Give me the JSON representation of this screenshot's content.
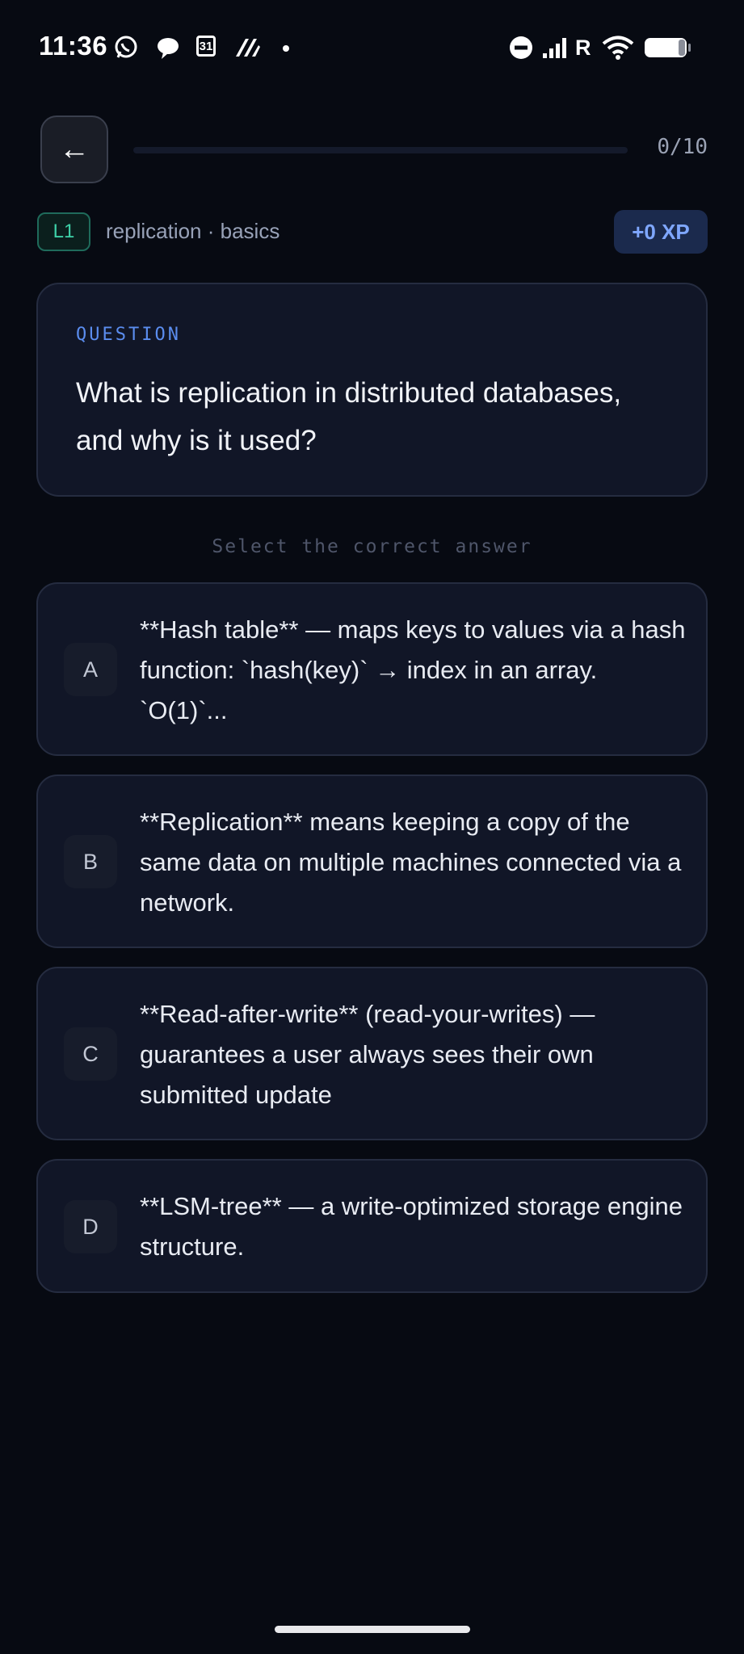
{
  "status_bar": {
    "time": "11:36",
    "calendar_day": "31",
    "carrier_indicator": "R"
  },
  "header": {
    "back_icon": "←",
    "progress": {
      "current": 0,
      "total": 10,
      "fraction": 0.0,
      "label": "0/10"
    }
  },
  "meta": {
    "level": "L1",
    "topic": "replication · basics",
    "xp": "+0 XP"
  },
  "question": {
    "label": "QUESTION",
    "text": "What is replication in distributed databases, and why is it used?"
  },
  "instruction": "Select the correct answer",
  "options": [
    {
      "letter": "A",
      "text": "**Hash table** — maps keys to values via a hash function: `hash(key)` → index in an array. `O(1)`..."
    },
    {
      "letter": "B",
      "text": "**Replication** means keeping a copy of the same data on multiple machines connected via a network."
    },
    {
      "letter": "C",
      "text": "**Read-after-write** (read-your-writes) — guarantees a user always sees their own submitted update"
    },
    {
      "letter": "D",
      "text": "**LSM-tree** — a write-optimized storage engine structure."
    }
  ],
  "colors": {
    "background": "#070a12",
    "card": "#111627",
    "accent": "#5b8def",
    "level_green": "#3ed1a8"
  },
  "icons": [
    "whatsapp-icon",
    "chat-bubble-icon",
    "calendar-icon",
    "app-icon",
    "dnd-icon",
    "signal-icon",
    "wifi-icon",
    "battery-icon",
    "back-arrow-icon"
  ]
}
